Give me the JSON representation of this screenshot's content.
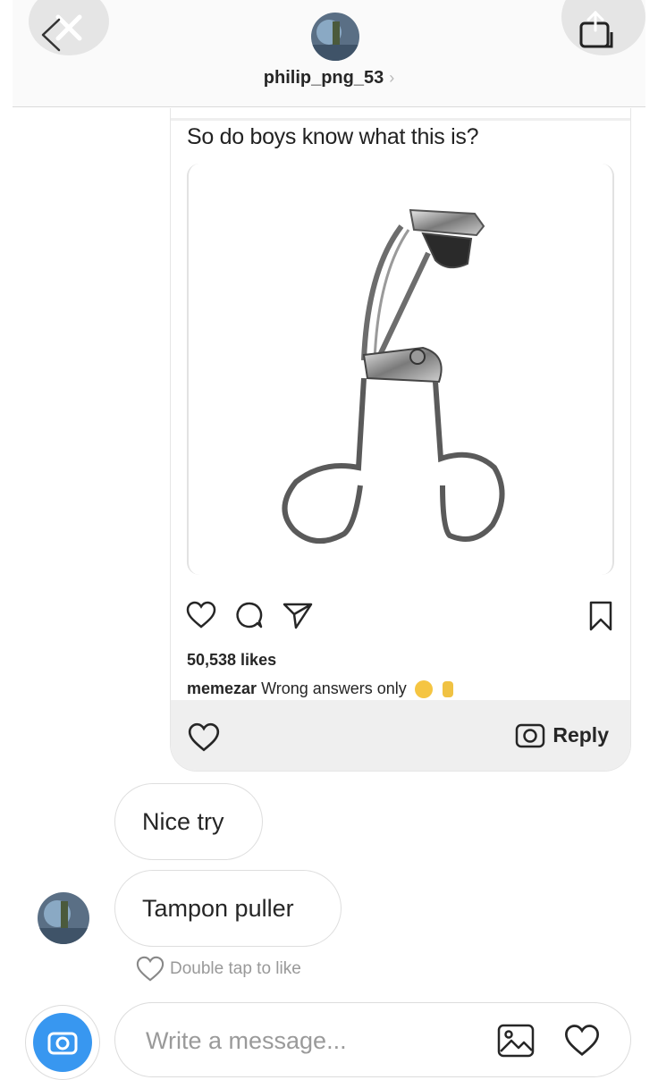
{
  "header": {
    "username": "philip_png_53",
    "chevron": "›"
  },
  "post": {
    "caption": "So do boys know what this is?",
    "likes": "50,538 likes",
    "comment_user": "memezar",
    "comment_text": "Wrong answers only",
    "reply_label": "Reply"
  },
  "messages": [
    {
      "text": "Nice try"
    },
    {
      "text": "Tampon puller"
    }
  ],
  "double_tap_label": "Double tap to like",
  "composer": {
    "placeholder": "Write a message..."
  },
  "colors": {
    "accent": "#3897f0",
    "bubble_border": "#dedede",
    "header_bg": "#fafafa"
  }
}
